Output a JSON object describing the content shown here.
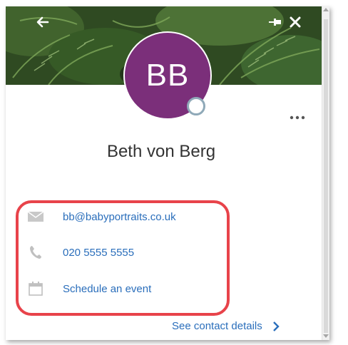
{
  "contact": {
    "initials": "BB",
    "name": "Beth von Berg"
  },
  "details": {
    "email": "bb@babyportraits.co.uk",
    "phone": "020 5555 5555",
    "schedule": "Schedule an event"
  },
  "footer": {
    "see_contact_details": "See contact details"
  },
  "icons": {
    "back": "arrow-left-icon",
    "pin": "pin-icon",
    "close": "close-icon",
    "more": "more-horizontal-icon",
    "mail": "mail-icon",
    "phone": "phone-icon",
    "calendar": "calendar-icon",
    "chevron": "chevron-right-icon"
  },
  "colors": {
    "avatar_bg": "#7b2f7a",
    "link": "#2a6ebb",
    "highlight": "#e8434a",
    "presence_ring": "#8fa9b8"
  }
}
